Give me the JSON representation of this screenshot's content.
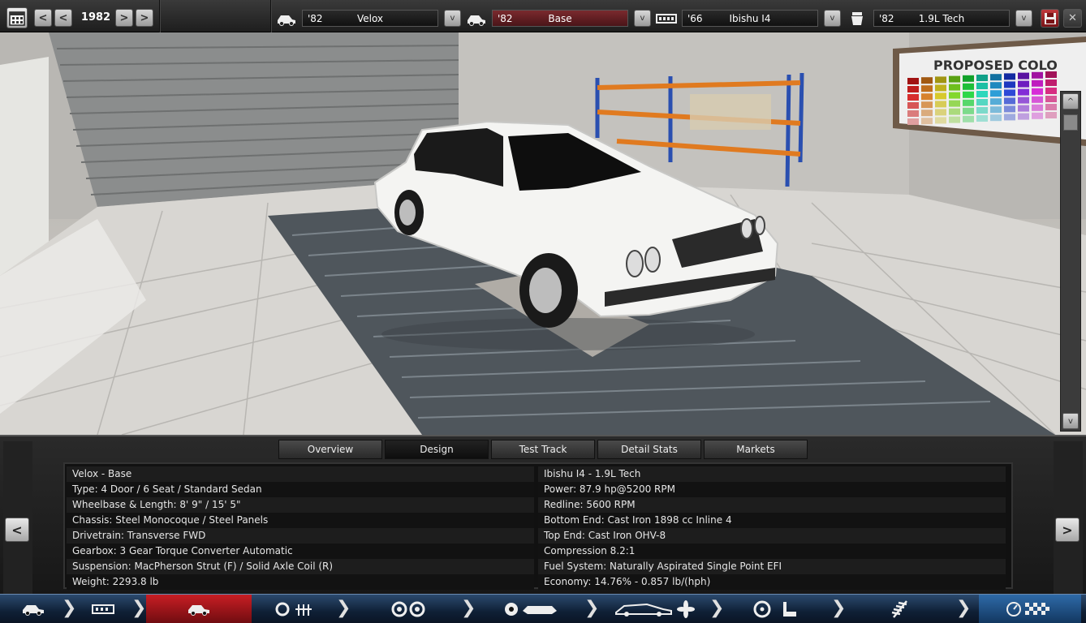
{
  "toolbar": {
    "year": "1982",
    "prev_big": "<",
    "prev": "<",
    "next": ">",
    "next_big": ">",
    "model": {
      "year": "'82",
      "name": "Velox"
    },
    "trim": {
      "year": "'82",
      "name": "Base"
    },
    "engine_family": {
      "year": "'66",
      "name": "Ibishu I4"
    },
    "engine_variant": {
      "year": "'82",
      "name": "1.9L Tech"
    },
    "caret": "v"
  },
  "scene": {
    "board_text": "PROPOSED COLO",
    "scroll_up": "^",
    "scroll_down": "v"
  },
  "tabs": [
    "Overview",
    "Design",
    "Test Track",
    "Detail Stats",
    "Markets"
  ],
  "active_tab": "Design",
  "nav": {
    "left": "<",
    "right": ">"
  },
  "details_left": [
    "Velox - Base",
    "Type: 4 Door / 6 Seat / Standard Sedan",
    "Wheelbase & Length: 8' 9\" / 15' 5\"",
    "Chassis: Steel Monocoque / Steel Panels",
    "Drivetrain: Transverse FWD",
    "Gearbox: 3 Gear Torque Converter Automatic",
    "Suspension: MacPherson Strut (F) / Solid Axle Coil (R)",
    "Weight: 2293.8 lb"
  ],
  "details_right": [
    "Ibishu I4 - 1.9L Tech",
    "Power: 87.9 hp@5200 RPM",
    "Redline: 5600 RPM",
    "Bottom End: Cast Iron 1898 cc Inline 4",
    "Top End: Cast Iron OHV-8",
    "Compression 8.2:1",
    "Fuel System: Naturally Aspirated Single Point EFI",
    "Economy: 14.76% - 0.857 lb/(hph)"
  ],
  "colors": {
    "accent_red": "#c81e24",
    "nav_blue": "#0f2036"
  }
}
